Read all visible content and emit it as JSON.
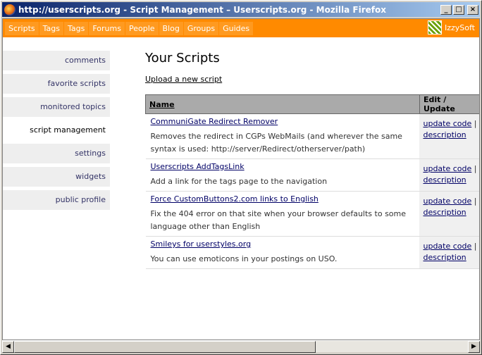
{
  "window": {
    "title": "http://userscripts.org - Script Management – Userscripts.org - Mozilla Firefox"
  },
  "nav": {
    "items": [
      "Scripts",
      "Tags",
      "Tags",
      "Forums",
      "People",
      "Blog",
      "Groups",
      "Guides"
    ],
    "brand": "IzzySoft"
  },
  "sidebar": {
    "items": [
      "comments",
      "favorite scripts",
      "monitored topics",
      "script management",
      "settings",
      "widgets",
      "public profile"
    ],
    "active": "script management"
  },
  "main": {
    "heading": "Your Scripts",
    "upload_link": "Upload a new script",
    "table": {
      "headers": [
        "Name",
        "Edit / Update"
      ],
      "rows": [
        {
          "name": "CommuniGate Redirect Remover",
          "desc": "Removes the redirect in CGPs WebMails (and wherever the same syntax is used: http://server/Redirect/otherserver/path)",
          "update": "update code",
          "sep": "|",
          "description": "description"
        },
        {
          "name": "Userscripts AddTagsLink",
          "desc": "Add a link for the tags page to the navigation",
          "update": "update code",
          "sep": "|",
          "description": "description"
        },
        {
          "name": "Force CustomButtons2.com links to English",
          "desc": "Fix the 404 error on that site when your browser defaults to some language other than English",
          "update": "update code",
          "sep": "|",
          "description": "description"
        },
        {
          "name": "Smileys for userstyles.org",
          "desc": "You can use emoticons in your postings on USO.",
          "update": "update code",
          "sep": "|",
          "description": "description"
        }
      ]
    }
  },
  "window_buttons": {
    "minimize": "_",
    "maximize": "□",
    "close": "×"
  },
  "scrollbar": {
    "left": "◀",
    "right": "▶"
  },
  "colors": {
    "nav_bg": "#ff8a00",
    "title_start": "#0a246a",
    "title_end": "#a6caf0"
  }
}
